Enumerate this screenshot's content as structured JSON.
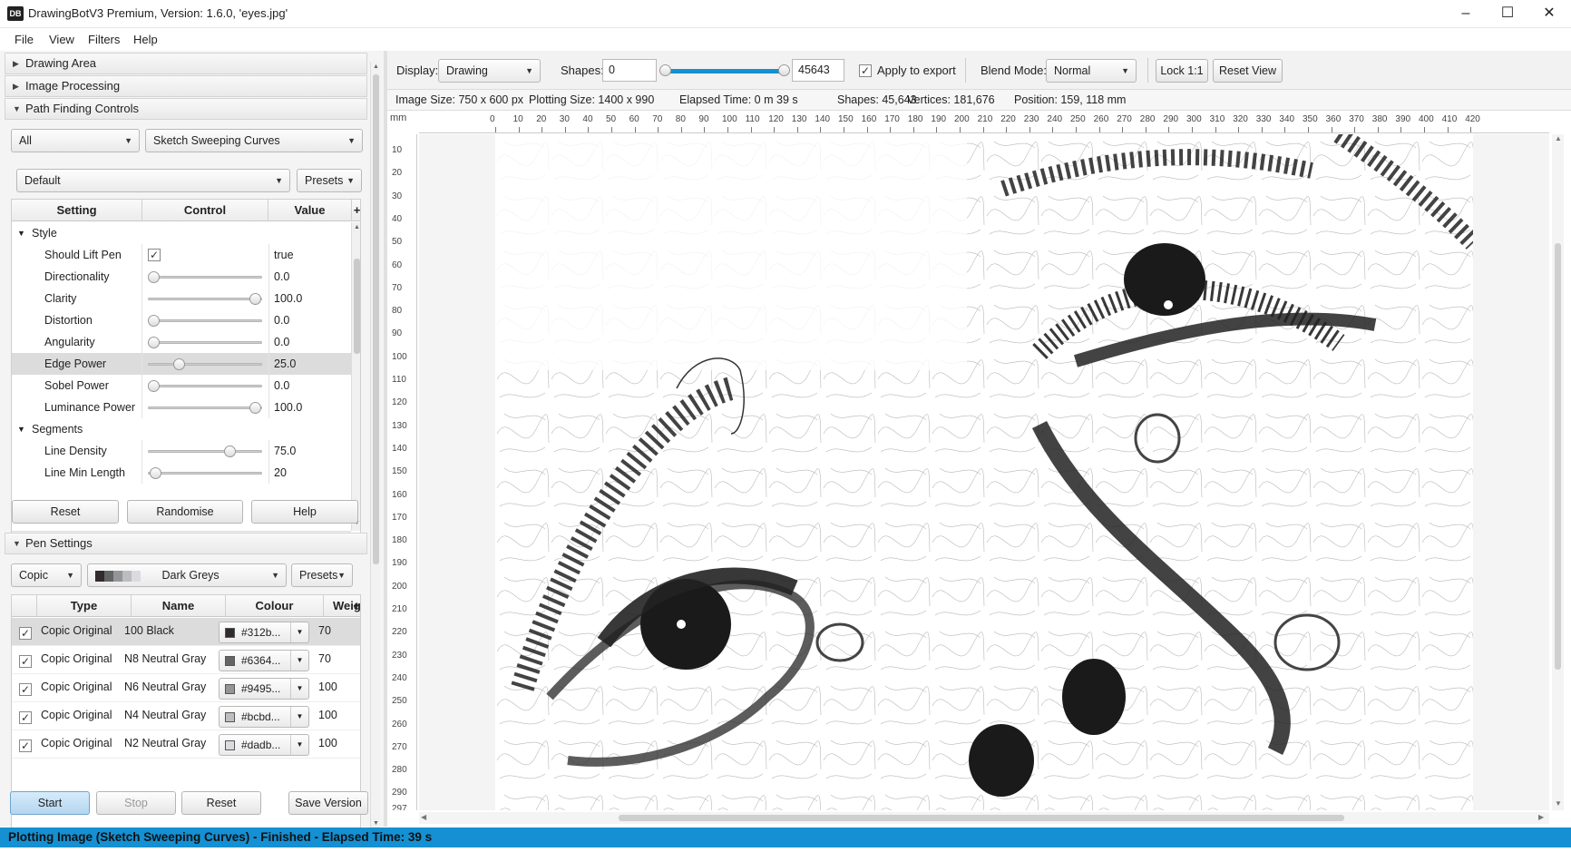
{
  "window": {
    "title": "DrawingBotV3 Premium, Version: 1.6.0, 'eyes.jpg'",
    "icon_text": "DB",
    "minimize": "–",
    "maximize": "☐",
    "close": "✕"
  },
  "menu": [
    "File",
    "View",
    "Filters",
    "Help"
  ],
  "panels": {
    "drawing_area": "Drawing Area",
    "image_processing": "Image Processing",
    "path_finding": "Path Finding Controls",
    "pen_settings": "Pen Settings"
  },
  "pfm": {
    "category": "All",
    "algorithm": "Sketch Sweeping Curves",
    "preset": "Default",
    "presets_btn": "Presets"
  },
  "settings_table": {
    "headers": [
      "Setting",
      "Control",
      "Value"
    ],
    "add": "+",
    "groups": [
      {
        "name": "Style",
        "items": [
          {
            "label": "Should Lift Pen",
            "type": "check",
            "value": "true"
          },
          {
            "label": "Directionality",
            "type": "slider",
            "level": 0.0,
            "value": "0.0"
          },
          {
            "label": "Clarity",
            "type": "slider",
            "level": 1.0,
            "value": "100.0"
          },
          {
            "label": "Distortion",
            "type": "slider",
            "level": 0.0,
            "value": "0.0"
          },
          {
            "label": "Angularity",
            "type": "slider",
            "level": 0.0,
            "value": "0.0"
          },
          {
            "label": "Edge Power",
            "type": "slider",
            "level": 0.25,
            "value": "25.0",
            "selected": true
          },
          {
            "label": "Sobel Power",
            "type": "slider",
            "level": 0.0,
            "value": "0.0"
          },
          {
            "label": "Luminance Power",
            "type": "slider",
            "level": 1.0,
            "value": "100.0"
          }
        ]
      },
      {
        "name": "Segments",
        "items": [
          {
            "label": "Line Density",
            "type": "slider",
            "level": 0.75,
            "value": "75.0"
          },
          {
            "label": "Line Min Length",
            "type": "slider",
            "level": 0.02,
            "value": "20"
          }
        ]
      }
    ]
  },
  "pfm_buttons": {
    "reset": "Reset",
    "randomise": "Randomise",
    "help": "Help"
  },
  "pens": {
    "manufacturer": "Copic",
    "set": "Dark Greys",
    "presets_btn": "Presets",
    "headers": [
      "Type",
      "Name",
      "Colour",
      "Weig"
    ],
    "add": "+",
    "rows": [
      {
        "type": "Copic Original",
        "name": "100 Black",
        "colour": "#312b...",
        "swatch": "#312b2b",
        "weight": "70",
        "selected": true
      },
      {
        "type": "Copic Original",
        "name": "N8 Neutral Gray",
        "colour": "#6364...",
        "swatch": "#636464",
        "weight": "70"
      },
      {
        "type": "Copic Original",
        "name": "N6 Neutral Gray",
        "colour": "#9495...",
        "swatch": "#949596",
        "weight": "100"
      },
      {
        "type": "Copic Original",
        "name": "N4 Neutral Gray",
        "colour": "#bcbd...",
        "swatch": "#bcbdc1",
        "weight": "100"
      },
      {
        "type": "Copic Original",
        "name": "N2 Neutral Gray",
        "colour": "#dadb...",
        "swatch": "#dadbdf",
        "weight": "100"
      }
    ]
  },
  "actions": {
    "start": "Start",
    "stop": "Stop",
    "reset": "Reset",
    "save_version": "Save Version"
  },
  "toolbar": {
    "display_label": "Display:",
    "display_value": "Drawing",
    "shapes_label": "Shapes:",
    "shapes_min": "0",
    "shapes_max": "45643",
    "apply_export": "Apply to export",
    "blend_label": "Blend Mode:",
    "blend_value": "Normal",
    "lock": "Lock 1:1",
    "reset_view": "Reset View"
  },
  "info": {
    "image_size": "Image Size: 750 x 600 px",
    "plotting_size": "Plotting Size: 1400 x 990",
    "elapsed": "Elapsed Time: 0 m 39 s",
    "shapes": "Shapes: 45,643",
    "vertices": "Vertices: 181,676",
    "position": "Position: 159, 118 mm"
  },
  "ruler": {
    "unit": "mm",
    "h": [
      "0",
      "10",
      "20",
      "30",
      "40",
      "50",
      "60",
      "70",
      "80",
      "90",
      "100",
      "110",
      "120",
      "130",
      "140",
      "150",
      "160",
      "170",
      "180",
      "190",
      "200",
      "210",
      "220",
      "230",
      "240",
      "250",
      "260",
      "270",
      "280",
      "290",
      "300",
      "310",
      "320",
      "330",
      "340",
      "350",
      "360",
      "370",
      "380",
      "390",
      "400",
      "410",
      "420"
    ],
    "v": [
      "10",
      "20",
      "30",
      "40",
      "50",
      "60",
      "70",
      "80",
      "90",
      "100",
      "110",
      "120",
      "130",
      "140",
      "150",
      "160",
      "170",
      "180",
      "190",
      "200",
      "210",
      "220",
      "230",
      "240",
      "250",
      "260",
      "270",
      "280",
      "290",
      "297"
    ]
  },
  "status": "Plotting Image (Sketch Sweeping Curves) - Finished - Elapsed Time: 39 s",
  "colors": {
    "accent": "#1590d2",
    "selected_row": "#dcdcdc",
    "start_btn": "#bfdcf2"
  }
}
